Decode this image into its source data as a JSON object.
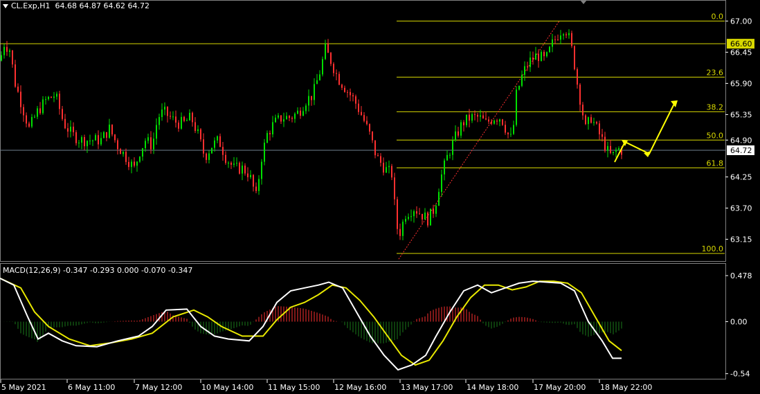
{
  "header": {
    "symbol": "CL.Exp,H1",
    "ohlc": "64.68 64.87 64.62 64.72"
  },
  "macd_header": "MACD(12,26,9) -0.347 -0.293 0.000 -0.070 -0.347",
  "colors": {
    "background": "#000000",
    "bull": "#00e000",
    "bear": "#ff3030",
    "fib": "#d8d800",
    "arrow": "#ffff00",
    "macd_main": "#ffffff",
    "macd_signal": "#e8e800",
    "hist_up": "#ff3030",
    "hist_down": "#1a7a1a",
    "axis": "#ffffff"
  },
  "chart_data": [
    {
      "type": "candlestick",
      "name": "price",
      "ylim": [
        62.9,
        67.2
      ],
      "y_ticks": [
        "67.00",
        "66.45",
        "65.90",
        "65.35",
        "64.90",
        "64.25",
        "63.70",
        "63.15"
      ],
      "y_tick_values": [
        67.0,
        66.45,
        65.9,
        65.35,
        64.9,
        64.25,
        63.7,
        63.15
      ],
      "x_labels": [
        "5 May 2021",
        "6 May 11:00",
        "7 May 12:00",
        "10 May 14:00",
        "11 May 15:00",
        "12 May 16:00",
        "13 May 17:00",
        "14 May 18:00",
        "17 May 20:00",
        "18 May 22:00"
      ],
      "current_price": "64.72",
      "current_price_value": 64.72,
      "resistance_label": "66.60",
      "resistance_value": 66.6,
      "path": [
        [
          0,
          66.3
        ],
        [
          6,
          66.6
        ],
        [
          14,
          66.5
        ],
        [
          22,
          65.9
        ],
        [
          32,
          65.5
        ],
        [
          42,
          65.1
        ],
        [
          54,
          65.4
        ],
        [
          66,
          65.6
        ],
        [
          80,
          65.7
        ],
        [
          92,
          65.2
        ],
        [
          104,
          65.0
        ],
        [
          116,
          64.9
        ],
        [
          130,
          64.9
        ],
        [
          146,
          64.9
        ],
        [
          158,
          65.1
        ],
        [
          170,
          64.8
        ],
        [
          182,
          64.6
        ],
        [
          194,
          64.4
        ],
        [
          202,
          64.7
        ],
        [
          210,
          64.9
        ],
        [
          220,
          64.8
        ],
        [
          228,
          65.3
        ],
        [
          236,
          65.4
        ],
        [
          246,
          65.3
        ],
        [
          256,
          65.2
        ],
        [
          266,
          65.2
        ],
        [
          276,
          65.3
        ],
        [
          286,
          65.0
        ],
        [
          296,
          64.6
        ],
        [
          306,
          64.8
        ],
        [
          316,
          64.9
        ],
        [
          326,
          64.6
        ],
        [
          338,
          64.4
        ],
        [
          350,
          64.4
        ],
        [
          360,
          64.3
        ],
        [
          370,
          63.9
        ],
        [
          378,
          64.6
        ],
        [
          386,
          65.0
        ],
        [
          396,
          65.2
        ],
        [
          408,
          65.3
        ],
        [
          420,
          65.3
        ],
        [
          432,
          65.4
        ],
        [
          442,
          65.6
        ],
        [
          452,
          65.7
        ],
        [
          462,
          66.1
        ],
        [
          470,
          66.5
        ],
        [
          478,
          66.3
        ],
        [
          488,
          66.0
        ],
        [
          500,
          65.8
        ],
        [
          512,
          65.6
        ],
        [
          524,
          65.3
        ],
        [
          534,
          65.0
        ],
        [
          544,
          64.6
        ],
        [
          556,
          64.4
        ],
        [
          566,
          64.3
        ],
        [
          572,
          63.5
        ],
        [
          576,
          63.2
        ],
        [
          586,
          63.6
        ],
        [
          598,
          63.7
        ],
        [
          608,
          63.6
        ],
        [
          618,
          63.5
        ],
        [
          628,
          63.7
        ],
        [
          636,
          64.2
        ],
        [
          646,
          64.6
        ],
        [
          656,
          64.9
        ],
        [
          668,
          65.2
        ],
        [
          680,
          65.3
        ],
        [
          692,
          65.3
        ],
        [
          702,
          65.2
        ],
        [
          714,
          65.3
        ],
        [
          724,
          65.3
        ],
        [
          734,
          65.0
        ],
        [
          740,
          64.9
        ],
        [
          746,
          65.7
        ],
        [
          756,
          66.1
        ],
        [
          766,
          66.3
        ],
        [
          776,
          66.4
        ],
        [
          788,
          66.3
        ],
        [
          798,
          66.6
        ],
        [
          808,
          66.8
        ],
        [
          816,
          66.9
        ],
        [
          822,
          66.7
        ],
        [
          828,
          66.4
        ],
        [
          834,
          65.9
        ],
        [
          840,
          65.5
        ],
        [
          846,
          65.1
        ],
        [
          854,
          65.3
        ],
        [
          862,
          65.1
        ],
        [
          870,
          64.9
        ],
        [
          878,
          64.7
        ],
        [
          884,
          64.6
        ],
        [
          892,
          64.75
        ],
        [
          898,
          64.72
        ]
      ]
    },
    {
      "type": "fibonacci",
      "levels": [
        {
          "label": "0.0",
          "value": 67.0
        },
        {
          "label": "23.6",
          "value": 66.01
        },
        {
          "label": "38.2",
          "value": 65.4
        },
        {
          "label": "50.0",
          "value": 64.9
        },
        {
          "label": "61.8",
          "value": 64.41
        },
        {
          "label": "100.0",
          "value": 62.8
        }
      ]
    },
    {
      "type": "macd",
      "ylim": [
        -0.6,
        0.55
      ],
      "y_ticks": [
        "0.478",
        "0.00",
        "-0.54"
      ],
      "y_tick_values": [
        0.478,
        0.0,
        -0.54
      ],
      "main": [
        [
          0,
          0.45
        ],
        [
          20,
          0.38
        ],
        [
          40,
          0.05
        ],
        [
          55,
          -0.18
        ],
        [
          70,
          -0.12
        ],
        [
          90,
          -0.2
        ],
        [
          110,
          -0.25
        ],
        [
          140,
          -0.26
        ],
        [
          170,
          -0.2
        ],
        [
          200,
          -0.15
        ],
        [
          220,
          -0.05
        ],
        [
          240,
          0.12
        ],
        [
          270,
          0.13
        ],
        [
          290,
          -0.05
        ],
        [
          310,
          -0.15
        ],
        [
          330,
          -0.18
        ],
        [
          360,
          -0.2
        ],
        [
          380,
          -0.05
        ],
        [
          400,
          0.2
        ],
        [
          420,
          0.32
        ],
        [
          440,
          0.35
        ],
        [
          460,
          0.38
        ],
        [
          475,
          0.41
        ],
        [
          495,
          0.35
        ],
        [
          515,
          0.1
        ],
        [
          535,
          -0.15
        ],
        [
          555,
          -0.35
        ],
        [
          575,
          -0.5
        ],
        [
          595,
          -0.45
        ],
        [
          615,
          -0.35
        ],
        [
          630,
          -0.15
        ],
        [
          650,
          0.1
        ],
        [
          670,
          0.32
        ],
        [
          690,
          0.38
        ],
        [
          710,
          0.3
        ],
        [
          730,
          0.35
        ],
        [
          750,
          0.4
        ],
        [
          770,
          0.42
        ],
        [
          790,
          0.41
        ],
        [
          810,
          0.4
        ],
        [
          830,
          0.32
        ],
        [
          850,
          0.0
        ],
        [
          870,
          -0.2
        ],
        [
          885,
          -0.38
        ],
        [
          898,
          -0.38
        ]
      ],
      "signal": [
        [
          0,
          0.45
        ],
        [
          30,
          0.35
        ],
        [
          50,
          0.1
        ],
        [
          70,
          -0.05
        ],
        [
          100,
          -0.18
        ],
        [
          130,
          -0.25
        ],
        [
          160,
          -0.22
        ],
        [
          190,
          -0.18
        ],
        [
          220,
          -0.12
        ],
        [
          250,
          0.05
        ],
        [
          280,
          0.12
        ],
        [
          300,
          0.05
        ],
        [
          320,
          -0.05
        ],
        [
          350,
          -0.15
        ],
        [
          380,
          -0.15
        ],
        [
          400,
          0.02
        ],
        [
          420,
          0.15
        ],
        [
          440,
          0.2
        ],
        [
          460,
          0.28
        ],
        [
          480,
          0.38
        ],
        [
          500,
          0.35
        ],
        [
          520,
          0.22
        ],
        [
          540,
          0.05
        ],
        [
          560,
          -0.15
        ],
        [
          580,
          -0.35
        ],
        [
          600,
          -0.45
        ],
        [
          620,
          -0.4
        ],
        [
          640,
          -0.2
        ],
        [
          660,
          0.05
        ],
        [
          680,
          0.25
        ],
        [
          700,
          0.38
        ],
        [
          720,
          0.38
        ],
        [
          740,
          0.33
        ],
        [
          760,
          0.36
        ],
        [
          780,
          0.42
        ],
        [
          800,
          0.42
        ],
        [
          820,
          0.4
        ],
        [
          840,
          0.3
        ],
        [
          860,
          0.05
        ],
        [
          880,
          -0.2
        ],
        [
          898,
          -0.3
        ]
      ]
    }
  ]
}
